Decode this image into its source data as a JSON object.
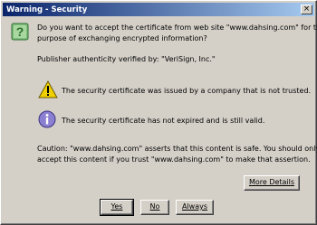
{
  "window": {
    "title": "Warning - Security",
    "close_glyph": "×"
  },
  "prompt": {
    "line1": "Do you want to accept the certificate from web site \"www.dahsing.com\" for the",
    "line2": "purpose of exchanging encrypted information?"
  },
  "publisher": {
    "text": "Publisher authenticity verified by: \"VeriSign, Inc.\""
  },
  "items": [
    {
      "icon": "warning-icon",
      "text": "The security certificate was issued by a company that is not trusted."
    },
    {
      "icon": "info-icon",
      "text": "The security certificate has not expired and is still valid."
    }
  ],
  "caution": {
    "line1": "Caution: \"www.dahsing.com\" asserts that this content is safe. You should only",
    "line2": "accept this content if you trust \"www.dahsing.com\" to make that assertion."
  },
  "buttons": {
    "more_details": "More Details",
    "yes": "Yes",
    "no": "No",
    "always": "Always"
  },
  "colors": {
    "title_start": "#0a246a",
    "title_end": "#a6caf0",
    "face": "#d4d0c8",
    "question": "#3c8c3c",
    "warning": "#e8c800",
    "info": "#7a6ec8"
  }
}
